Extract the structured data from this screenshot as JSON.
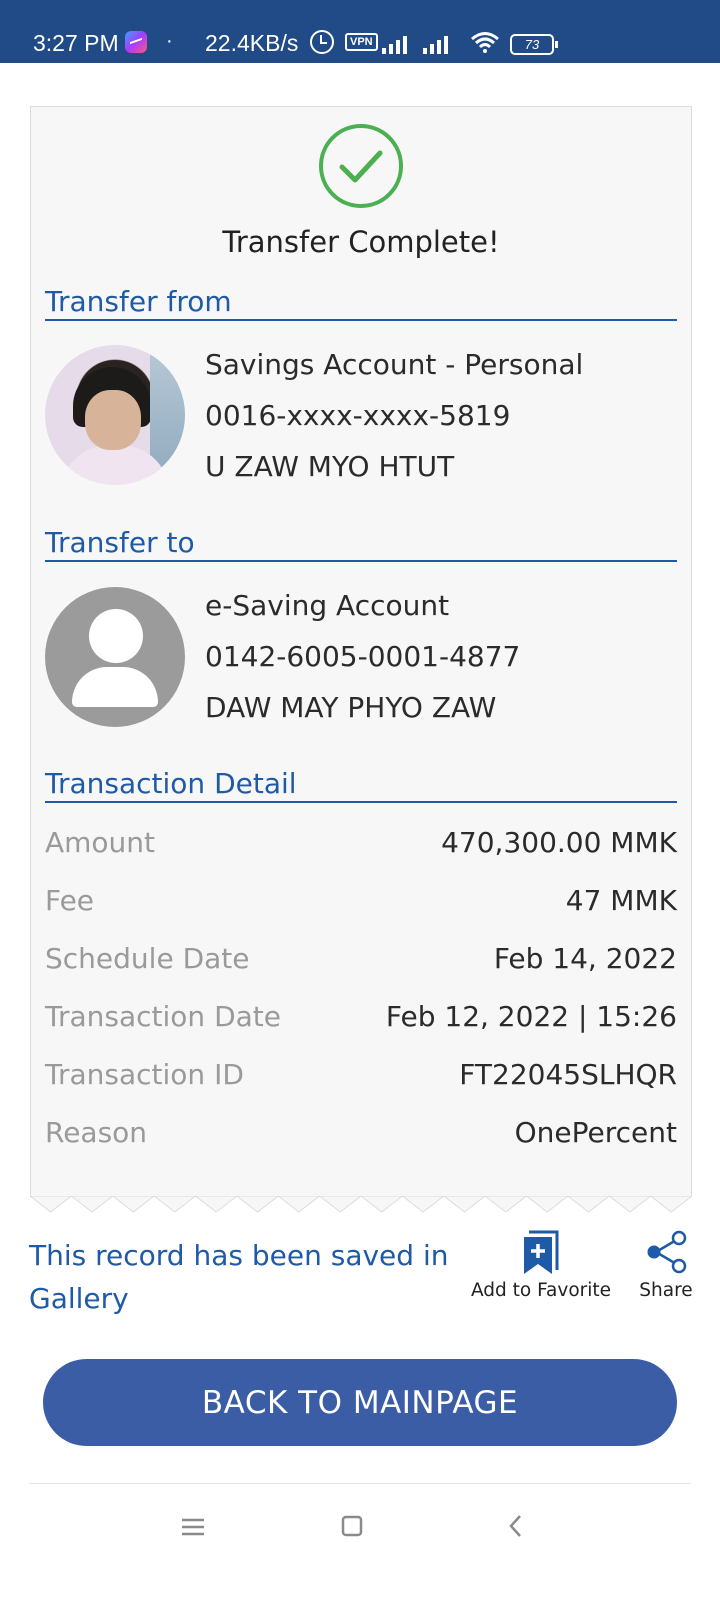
{
  "status_bar": {
    "time": "3:27 PM",
    "dot": "·",
    "speed": "22.4KB/s",
    "vpn": "VPN",
    "battery": "73",
    "icons": [
      "messenger-icon",
      "alarm-icon",
      "vpn-icon",
      "signal-icon",
      "signal-icon",
      "wifi-icon",
      "battery-icon"
    ]
  },
  "receipt": {
    "title": "Transfer Complete!",
    "from": {
      "heading": "Transfer from",
      "account_type": "Savings Account - Personal",
      "account_number": "0016-xxxx-xxxx-5819",
      "name": "U ZAW MYO HTUT"
    },
    "to": {
      "heading": "Transfer to",
      "account_type": "e-Saving Account",
      "account_number": "0142-6005-0001-4877",
      "name": "DAW MAY PHYO ZAW"
    },
    "detail": {
      "heading": "Transaction Detail",
      "rows": [
        {
          "label": "Amount",
          "value": "470,300.00 MMK"
        },
        {
          "label": "Fee",
          "value": "47 MMK"
        },
        {
          "label": "Schedule Date",
          "value": "Feb 14, 2022"
        },
        {
          "label": "Transaction Date",
          "value": "Feb 12, 2022 | 15:26"
        },
        {
          "label": "Transaction ID",
          "value": "FT22045SLHQR"
        },
        {
          "label": "Reason",
          "value": "OnePercent"
        }
      ]
    }
  },
  "actions": {
    "saved_message": "This record has been saved in Gallery",
    "favorite_label": "Add to Favorite",
    "share_label": "Share"
  },
  "back_button": "BACK TO MAINPAGE",
  "colors": {
    "status_bar": "#214b86",
    "accent": "#1f5aa8",
    "button": "#3a5da6",
    "success": "#4caf50"
  }
}
